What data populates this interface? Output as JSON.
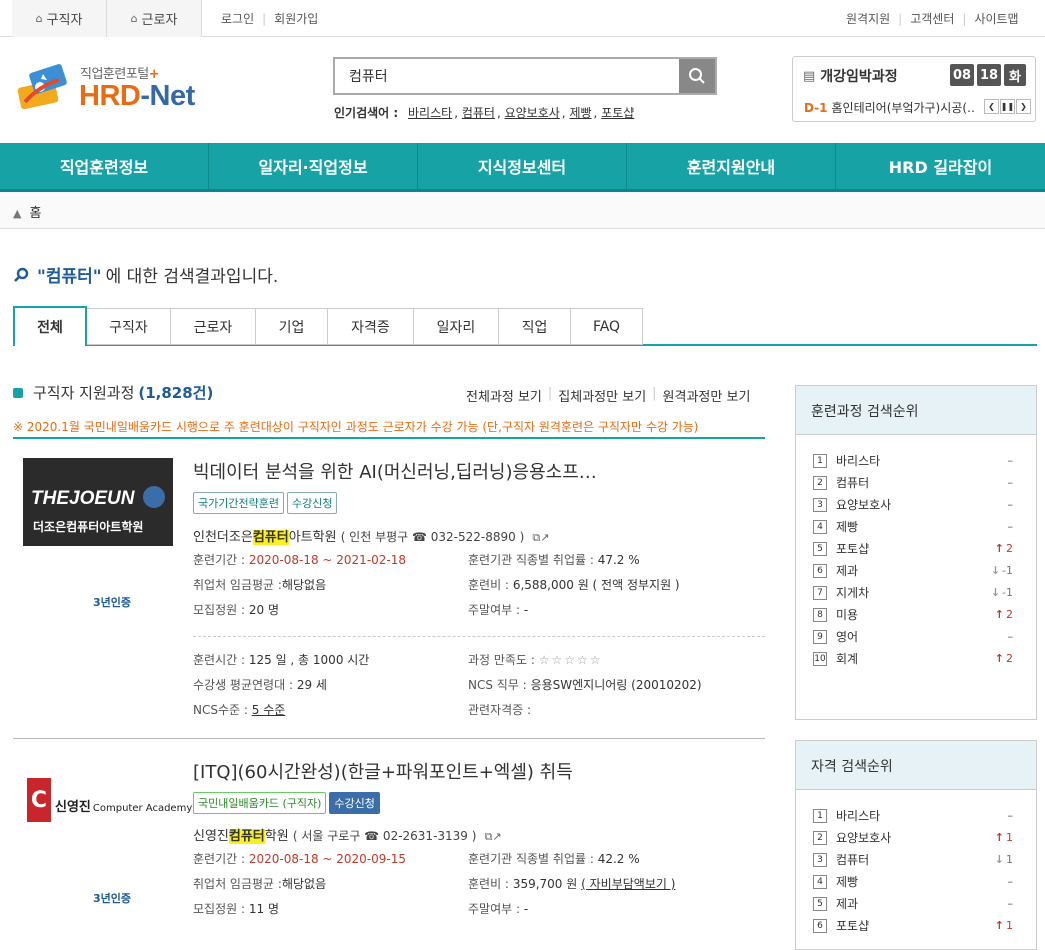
{
  "topbar": {
    "tab_job_seeker": "구직자",
    "tab_worker": "근로자",
    "login": "로그인",
    "signup": "회원가입",
    "remote_support": "원격지원",
    "customer_center": "고객센터",
    "sitemap": "사이트맵"
  },
  "logo": {
    "sub": "직업훈련포털",
    "main_a": "HRD",
    "main_b": "-Net"
  },
  "search": {
    "value": "컴퓨터",
    "popular_label": "인기검색어 :",
    "popular": [
      "바리스타",
      "컴퓨터",
      "요양보호사",
      "제빵",
      "포토샵"
    ]
  },
  "upcoming": {
    "title": "개강임박과정",
    "month": "08",
    "day": "18",
    "weekday": "화",
    "dday": "D-1",
    "course": "홈인테리어(부엌가구)시공(…"
  },
  "gnb": [
    "직업훈련정보",
    "일자리·직업정보",
    "지식정보센터",
    "훈련지원안내",
    "HRD 길라잡이"
  ],
  "breadcrumb": {
    "home": "홈"
  },
  "result": {
    "keyword": "\"컴퓨터\"",
    "suffix": "에 대한 검색결과입니다."
  },
  "tabs": [
    "전체",
    "구직자",
    "근로자",
    "기업",
    "자격증",
    "일자리",
    "직업",
    "FAQ"
  ],
  "section": {
    "title": "구직자 지원과정",
    "count": "(1,828건)",
    "view_all": "전체과정 보기",
    "view_group": "집체과정만 보기",
    "view_remote": "원격과정만 보기",
    "notice": "※ 2020.1월 국민내일배움카드 시행으로 주 훈련대상이 구직자인 과정도 근로자가 수강 가능 (단,구직자 원격훈련은 구직자만 수강 가능)"
  },
  "courses": [
    {
      "title": "빅데이터 분석을 위한 AI(머신러닝,딥러닝)응용소프…",
      "badges": [
        "국가기간전략훈련",
        "수강신청"
      ],
      "logo_text_a": "THEJOEUN",
      "logo_text_b": "더조은컴퓨터아트학원",
      "cert": "3년인증",
      "org_pre": "인천더조은",
      "org_hl": "컴퓨터",
      "org_post": "아트학원",
      "addr": "( 인천 부평구 ☎ 032-522-8890 )",
      "period_label": "훈련기간 :",
      "period": "2020-08-18 ~ 2021-02-18",
      "wage_label": "취업처 임금평균 :",
      "wage": "해당없음",
      "capacity_label": "모집정원 :",
      "capacity": "20 명",
      "employ_label": "훈련기관 직종별 취업률 :",
      "employ": "47.2 %",
      "fee_label": "훈련비 :",
      "fee": "6,588,000 원 ( 전액 정부지원 )",
      "weekend_label": "주말여부 :",
      "weekend": "-",
      "hours_label": "훈련시간 :",
      "hours": "125 일 , 총 1000 시간",
      "age_label": "수강생 평균연령대 :",
      "age": "29 세",
      "ncs_level_label": "NCS수준 :",
      "ncs_level": "5 수준",
      "satisfaction_label": "과정 만족도 :",
      "satisfaction_stars": "☆☆☆☆☆",
      "ncs_job_label": "NCS 직무 :",
      "ncs_job": "응용SW엔지니어링 (20010202)",
      "cert_related_label": "관련자격증 :",
      "cert_related": ""
    },
    {
      "title": "[ITQ](60시간완성)(한글+파워포인트+엑셀) 취득",
      "badges": [
        "국민내일배움카드 (구직자)",
        "수강신청"
      ],
      "logo_text_a": "신영진",
      "logo_text_b": "Computer Academy",
      "cert": "3년인증",
      "org_pre": "신영진",
      "org_hl": "컴퓨터",
      "org_post": "학원",
      "addr": "( 서울 구로구 ☎ 02-2631-3139 )",
      "period_label": "훈련기간 :",
      "period": "2020-08-18 ~ 2020-09-15",
      "wage_label": "취업처 임금평균 :",
      "wage": "해당없음",
      "capacity_label": "모집정원 :",
      "capacity": "11 명",
      "employ_label": "훈련기관 직종별 취업률 :",
      "employ": "42.2 %",
      "fee_label": "훈련비 :",
      "fee": "359,700 원",
      "fee_link": "( 자비부담액보기 )",
      "weekend_label": "주말여부 :",
      "weekend": "-"
    }
  ],
  "ranking_training": {
    "title": "훈련과정 검색순위",
    "items": [
      {
        "n": "1",
        "name": "바리스타",
        "change": "–",
        "dir": "none"
      },
      {
        "n": "2",
        "name": "컴퓨터",
        "change": "–",
        "dir": "none"
      },
      {
        "n": "3",
        "name": "요양보호사",
        "change": "–",
        "dir": "none"
      },
      {
        "n": "4",
        "name": "제빵",
        "change": "–",
        "dir": "none"
      },
      {
        "n": "5",
        "name": "포토샵",
        "change": "2",
        "dir": "up"
      },
      {
        "n": "6",
        "name": "제과",
        "change": "-1",
        "dir": "down"
      },
      {
        "n": "7",
        "name": "지게차",
        "change": "-1",
        "dir": "down"
      },
      {
        "n": "8",
        "name": "미용",
        "change": "2",
        "dir": "up"
      },
      {
        "n": "9",
        "name": "영어",
        "change": "–",
        "dir": "none"
      },
      {
        "n": "10",
        "name": "회계",
        "change": "2",
        "dir": "up"
      }
    ]
  },
  "ranking_cert": {
    "title": "자격 검색순위",
    "items": [
      {
        "n": "1",
        "name": "바리스타",
        "change": "–",
        "dir": "none"
      },
      {
        "n": "2",
        "name": "요양보호사",
        "change": "1",
        "dir": "up"
      },
      {
        "n": "3",
        "name": "컴퓨터",
        "change": "1",
        "dir": "down"
      },
      {
        "n": "4",
        "name": "제빵",
        "change": "–",
        "dir": "none"
      },
      {
        "n": "5",
        "name": "제과",
        "change": "–",
        "dir": "none"
      },
      {
        "n": "6",
        "name": "포토샵",
        "change": "1",
        "dir": "up"
      }
    ]
  }
}
